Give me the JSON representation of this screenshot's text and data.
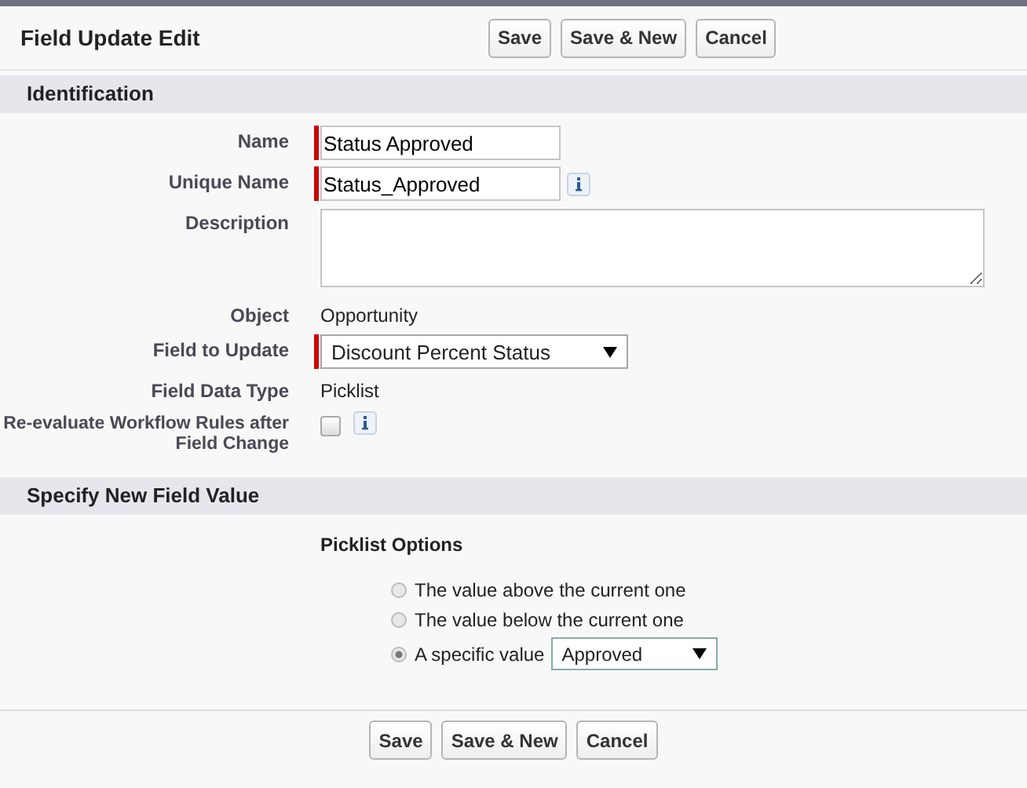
{
  "header": {
    "title": "Field Update Edit",
    "buttons": [
      "Save",
      "Save & New",
      "Cancel"
    ]
  },
  "identification": {
    "title": "Identification",
    "fields": [
      {
        "kind": "text",
        "label": "Name",
        "value": "Status Approved",
        "required": true
      },
      {
        "kind": "text",
        "label": "Unique Name",
        "value": "Status_Approved",
        "required": true,
        "info": true
      },
      {
        "kind": "textarea",
        "label": "Description"
      },
      {
        "kind": "static",
        "label": "Object",
        "value": "Opportunity"
      },
      {
        "kind": "select",
        "label": "Field to Update",
        "value": "Discount Percent Status",
        "required": true
      },
      {
        "kind": "static",
        "label": "Field Data Type",
        "value": "Picklist"
      },
      {
        "kind": "checkbox",
        "label": "Re-evaluate Workflow Rules after Field Change",
        "checked": false,
        "info": true
      }
    ]
  },
  "new_value": {
    "title": "Specify New Field Value",
    "options_label": "Picklist Options",
    "options": [
      {
        "label": "The value above the current one",
        "selected": false
      },
      {
        "label": "The value below the current one",
        "selected": false
      },
      {
        "label": "A specific value",
        "selected": true,
        "select_value": "Approved"
      }
    ]
  },
  "footer": {
    "buttons": [
      "Save",
      "Save & New",
      "Cancel"
    ]
  }
}
